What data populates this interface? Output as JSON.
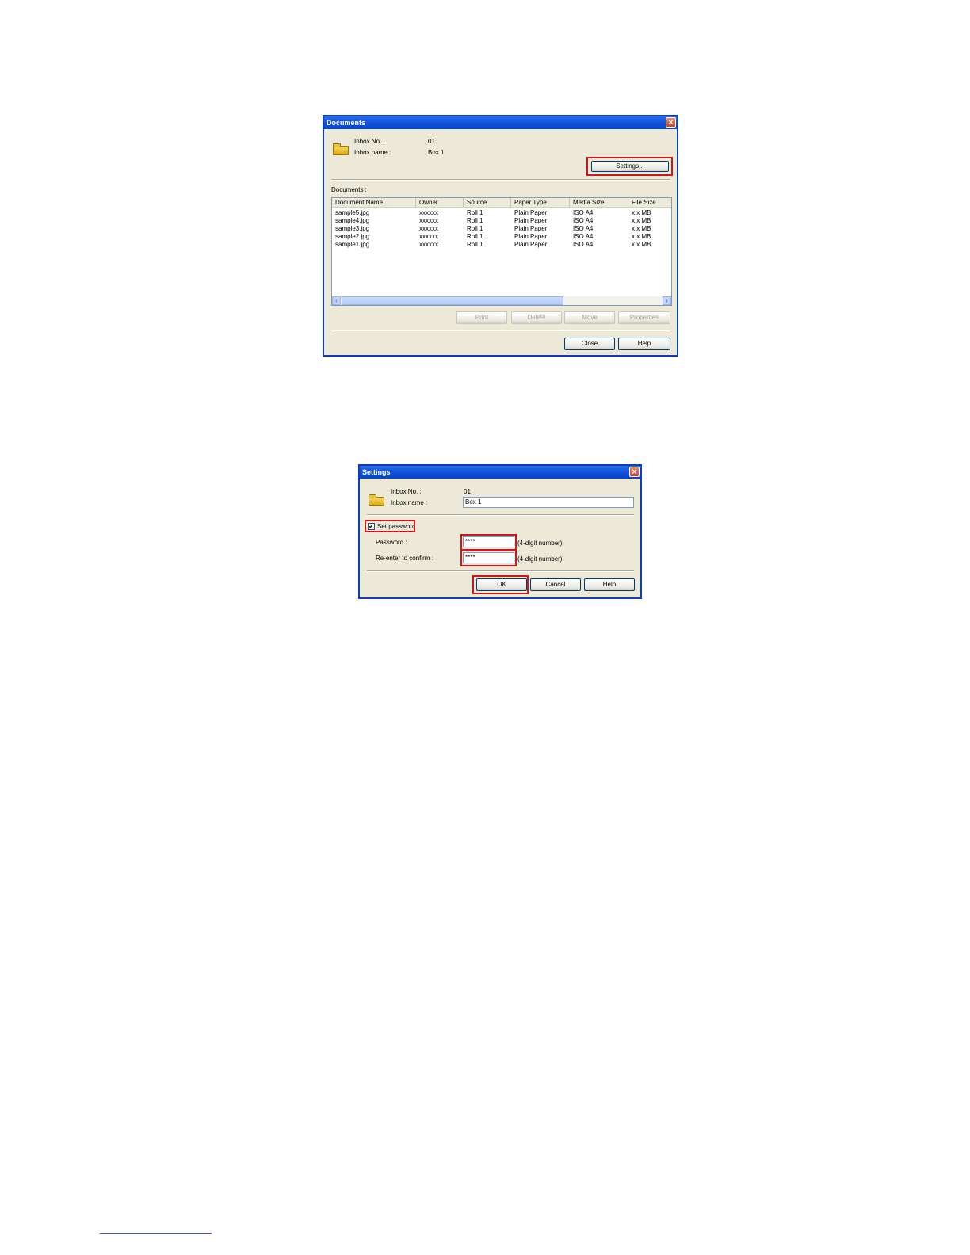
{
  "documents_dialog": {
    "title": "Documents",
    "inbox_no_label": "Inbox No. :",
    "inbox_no_value": "01",
    "inbox_name_label": "Inbox name :",
    "inbox_name_value": "Box 1",
    "settings_button": "Settings...",
    "documents_label": "Documents :",
    "columns": [
      "Document Name",
      "Owner",
      "Source",
      "Paper Type",
      "Media Size",
      "File Size"
    ],
    "rows": [
      [
        "sample5.jpg",
        "xxxxxx",
        "Roll 1",
        "Plain Paper",
        "ISO A4",
        "x.x MB"
      ],
      [
        "sample4.jpg",
        "xxxxxx",
        "Roll 1",
        "Plain Paper",
        "ISO A4",
        "x.x MB"
      ],
      [
        "sample3.jpg",
        "xxxxxx",
        "Roll 1",
        "Plain Paper",
        "ISO A4",
        "x.x MB"
      ],
      [
        "sample2.jpg",
        "xxxxxx",
        "Roll 1",
        "Plain Paper",
        "ISO A4",
        "x.x MB"
      ],
      [
        "sample1.jpg",
        "xxxxxx",
        "Roll 1",
        "Plain Paper",
        "ISO A4",
        "x.x MB"
      ]
    ],
    "print_button": "Print",
    "delete_button": "Delete",
    "move_button": "Move",
    "properties_button": "Properties",
    "close_button": "Close",
    "help_button": "Help"
  },
  "settings_dialog": {
    "title": "Settings",
    "inbox_no_label": "Inbox No. :",
    "inbox_no_value": "01",
    "inbox_name_label": "Inbox name :",
    "inbox_name_value": "Box 1",
    "set_password_label": "Set password",
    "set_password_checked": "✔",
    "password_label": "Password :",
    "password_value": "****",
    "password_hint": "(4-digit number)",
    "reenter_label": "Re-enter to confirm :",
    "reenter_value": "****",
    "reenter_hint": "(4-digit number)",
    "ok_button": "OK",
    "cancel_button": "Cancel",
    "help_button": "Help"
  },
  "colors": {
    "highlight": "#d0181c",
    "titlebar": "#0b4fd6",
    "dialog_bg": "#ece9d8"
  }
}
